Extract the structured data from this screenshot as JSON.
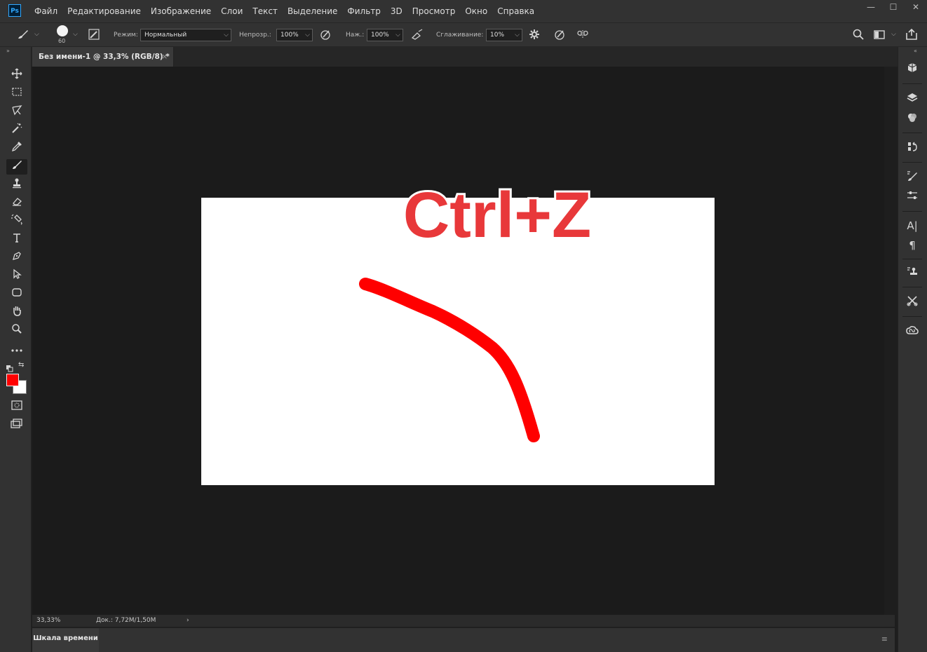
{
  "app": {
    "logo": "Ps"
  },
  "menu": [
    "Файл",
    "Редактирование",
    "Изображение",
    "Слои",
    "Текст",
    "Выделение",
    "Фильтр",
    "3D",
    "Просмотр",
    "Окно",
    "Справка"
  ],
  "window_controls": {
    "minimize": "—",
    "maximize": "☐",
    "close": "✕"
  },
  "options": {
    "brush_size": "60",
    "mode_label": "Режим:",
    "mode_value": "Нормальный",
    "opacity_label": "Непрозр.:",
    "opacity_value": "100%",
    "flow_label": "Наж.:",
    "flow_value": "100%",
    "smoothing_label": "Сглаживание:",
    "smoothing_value": "10%"
  },
  "document_tab": {
    "title": "Без имени-1 @ 33,3% (RGB/8) *",
    "close": "×"
  },
  "overlay_text": "Ctrl+Z",
  "colors": {
    "foreground": "#ff0000",
    "background": "#ffffff",
    "stroke": "#ff0000",
    "headline_fill": "#e8383a"
  },
  "status": {
    "zoom": "33,33%",
    "doc": "Док.: 7,72M/1,50M",
    "arrow": "›"
  },
  "timeline": {
    "label": "Шкала времени"
  },
  "tools": [
    "move-icon",
    "marquee-icon",
    "lasso-icon",
    "magic-wand-icon",
    "eyedropper-icon",
    "brush-icon",
    "stamp-icon",
    "eraser-icon",
    "gradient-icon",
    "type-icon",
    "pen-icon",
    "path-select-icon",
    "shape-icon",
    "hand-icon",
    "zoom-icon",
    "more-icon"
  ]
}
